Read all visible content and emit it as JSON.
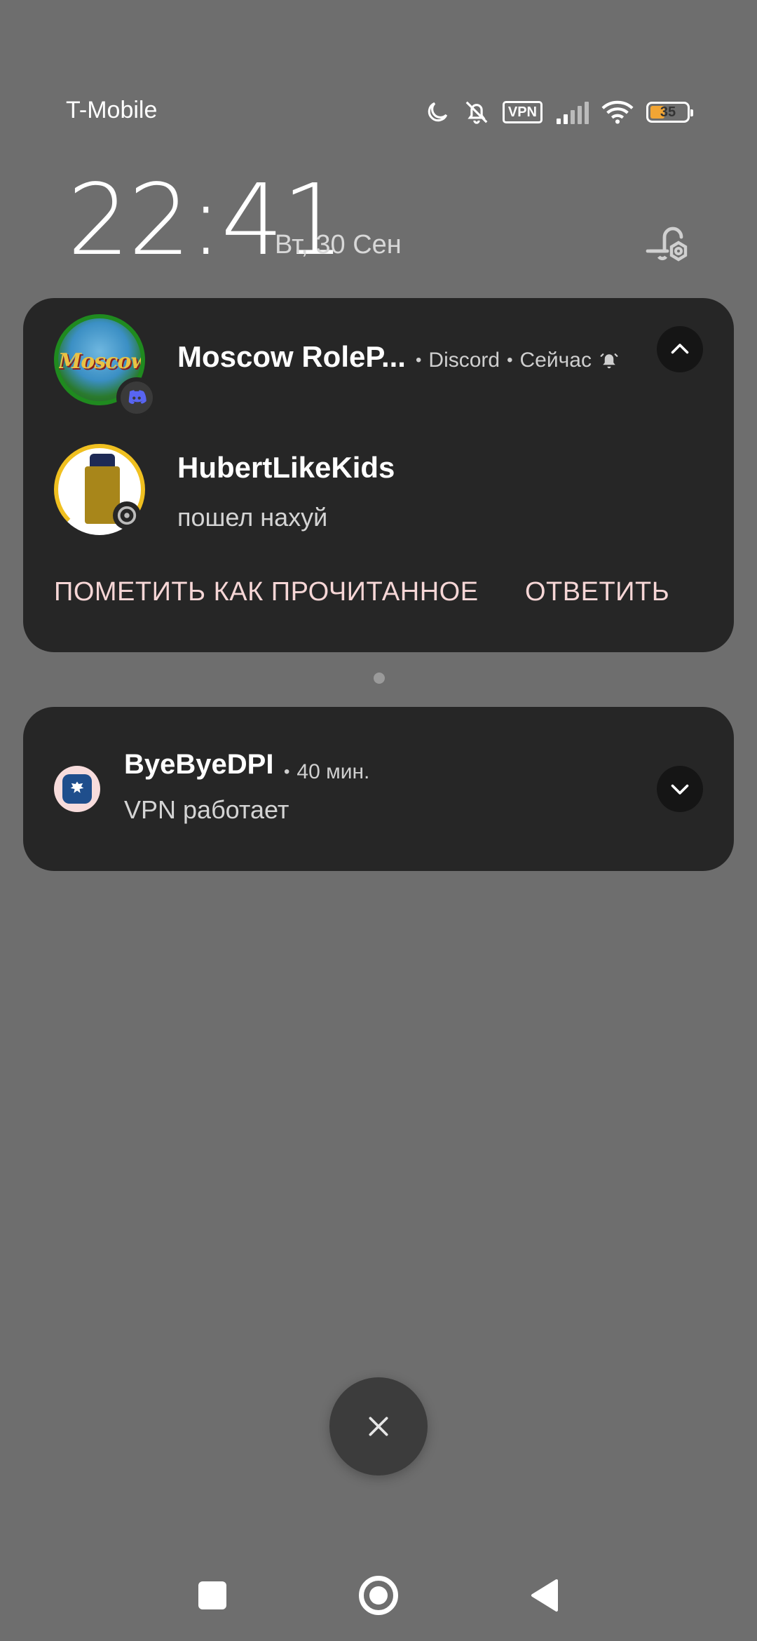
{
  "status_bar": {
    "carrier": "T-Mobile",
    "vpn_label": "VPN",
    "battery_level": "35",
    "battery_fraction": 0.35,
    "icons": [
      "moon-icon",
      "bell-off-icon",
      "vpn-icon",
      "signal-icon",
      "wifi-icon",
      "battery-icon"
    ]
  },
  "lockscreen": {
    "time": "22:41",
    "date": "Вт, 30 Сен"
  },
  "notifications": [
    {
      "title": "Moscow RoleP...",
      "app": "Discord",
      "time": "Сейчас",
      "server_avatar_text": "Moscow",
      "sender": "HubertLikeKids",
      "message": "пошел нахуй",
      "actions": {
        "mark_read": "ПОМЕТИТЬ КАК ПРОЧИТАННОЕ",
        "reply": "ОТВЕТИТЬ"
      }
    },
    {
      "title": "ByeByeDPI",
      "time": "40 мин.",
      "text": "VPN работает"
    }
  ],
  "colors": {
    "background": "#6e6e6e",
    "card": "#262626",
    "action_text": "#f6d6d6",
    "battery_fill": "#f2a534",
    "discord": "#5865f2"
  }
}
